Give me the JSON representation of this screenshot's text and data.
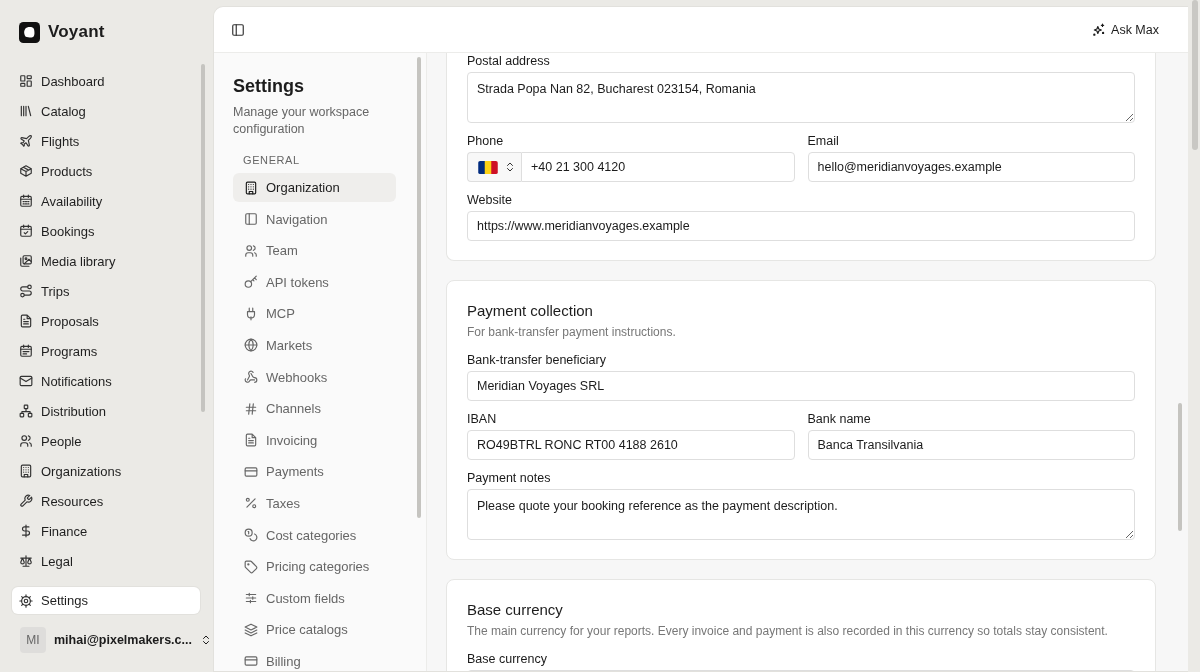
{
  "brand": {
    "name": "Voyant"
  },
  "nav": [
    {
      "label": "Dashboard",
      "selected": false
    },
    {
      "label": "Catalog",
      "selected": false
    },
    {
      "label": "Flights",
      "selected": false
    },
    {
      "label": "Products",
      "selected": false
    },
    {
      "label": "Availability",
      "selected": false
    },
    {
      "label": "Bookings",
      "selected": false
    },
    {
      "label": "Media library",
      "selected": false
    },
    {
      "label": "Trips",
      "selected": false
    },
    {
      "label": "Proposals",
      "selected": false
    },
    {
      "label": "Programs",
      "selected": false
    },
    {
      "label": "Notifications",
      "selected": false
    },
    {
      "label": "Distribution",
      "selected": false
    },
    {
      "label": "People",
      "selected": false
    },
    {
      "label": "Organizations",
      "selected": false
    },
    {
      "label": "Resources",
      "selected": false
    },
    {
      "label": "Finance",
      "selected": false
    },
    {
      "label": "Legal",
      "selected": false
    }
  ],
  "settings_nav": {
    "label": "Settings",
    "selected": true
  },
  "user": {
    "initials": "MI",
    "email": "mihai@pixelmakers.c..."
  },
  "topbar": {
    "ask_button": "Ask Max"
  },
  "settings": {
    "title": "Settings",
    "subtitle": "Manage your workspace configuration",
    "section": "GENERAL",
    "items": [
      {
        "label": "Organization",
        "selected": true
      },
      {
        "label": "Navigation",
        "selected": false
      },
      {
        "label": "Team",
        "selected": false
      },
      {
        "label": "API tokens",
        "selected": false
      },
      {
        "label": "MCP",
        "selected": false
      },
      {
        "label": "Markets",
        "selected": false
      },
      {
        "label": "Webhooks",
        "selected": false
      },
      {
        "label": "Channels",
        "selected": false
      },
      {
        "label": "Invoicing",
        "selected": false
      },
      {
        "label": "Payments",
        "selected": false
      },
      {
        "label": "Taxes",
        "selected": false
      },
      {
        "label": "Cost categories",
        "selected": false
      },
      {
        "label": "Pricing categories",
        "selected": false
      },
      {
        "label": "Custom fields",
        "selected": false
      },
      {
        "label": "Price catalogs",
        "selected": false
      },
      {
        "label": "Billing",
        "selected": false
      }
    ]
  },
  "cards": [
    {
      "rows": [
        [
          {
            "kind": "textarea",
            "label": "Postal address",
            "value": "Strada Popa Nan 82, Bucharest 023154, Romania"
          }
        ],
        [
          {
            "kind": "phone",
            "label": "Phone",
            "value": "+40 21 300 4120"
          },
          {
            "kind": "text",
            "label": "Email",
            "value": "hello@meridianvoyages.example"
          }
        ],
        [
          {
            "kind": "text",
            "label": "Website",
            "value": "https://www.meridianvoyages.example"
          }
        ]
      ]
    },
    {
      "title": "Payment collection",
      "description": "For bank-transfer payment instructions.",
      "rows": [
        [
          {
            "kind": "text",
            "label": "Bank-transfer beneficiary",
            "value": "Meridian Voyages SRL"
          }
        ],
        [
          {
            "kind": "text",
            "label": "IBAN",
            "value": "RO49BTRL RONC RT00 4188 2610"
          },
          {
            "kind": "text",
            "label": "Bank name",
            "value": "Banca Transilvania"
          }
        ],
        [
          {
            "kind": "textarea",
            "label": "Payment notes",
            "value": "Please quote your booking reference as the payment description."
          }
        ]
      ]
    },
    {
      "title": "Base currency",
      "description": "The main currency for your reports. Every invoice and payment is also recorded in this currency so totals stay consistent.",
      "rows": [
        [
          {
            "kind": "text",
            "label": "Base currency"
          }
        ]
      ]
    }
  ]
}
